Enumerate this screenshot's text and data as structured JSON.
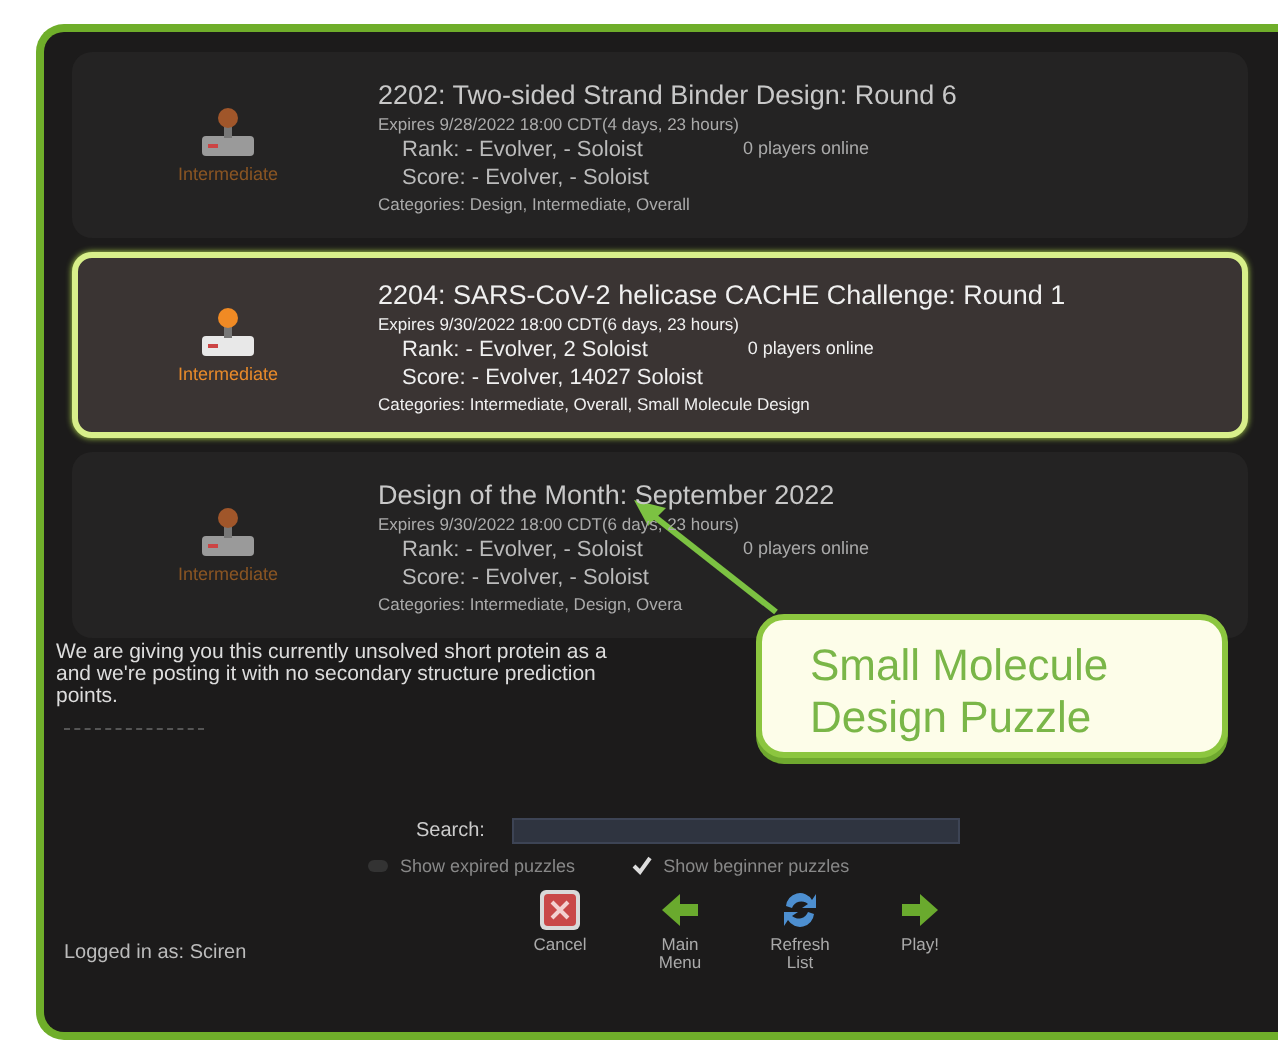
{
  "puzzles": [
    {
      "title": "2202: Two-sided Strand Binder Design: Round 6",
      "expires": "Expires 9/28/2022 18:00 CDT(4 days, 23 hours)",
      "rank": "Rank: - Evolver, - Soloist",
      "players": "0 players online",
      "score": "Score: - Evolver, - Soloist",
      "categories": "Categories: Design, Intermediate, Overall",
      "difficulty": "Intermediate",
      "selected": false
    },
    {
      "title": "2204: SARS-CoV-2 helicase CACHE Challenge: Round 1",
      "expires": "Expires 9/30/2022 18:00 CDT(6 days, 23 hours)",
      "rank": "Rank: - Evolver, 2 Soloist",
      "players": "0 players online",
      "score": "Score: - Evolver, 14027 Soloist",
      "categories": "Categories: Intermediate, Overall, Small Molecule Design",
      "difficulty": "Intermediate",
      "selected": true
    },
    {
      "title": "Design of the Month: September 2022",
      "expires": "Expires 9/30/2022 18:00 CDT(6 days, 23 hours)",
      "rank": "Rank: - Evolver, - Soloist",
      "players": "0 players online",
      "score": "Score: - Evolver, - Soloist",
      "categories": "Categories: Intermediate, Design, Overa",
      "difficulty": "Intermediate",
      "selected": false
    }
  ],
  "description": "We are giving you this currently unsolved short protein as a\nand we're posting it with no secondary structure prediction\npoints.",
  "search": {
    "label": "Search:"
  },
  "options": [
    {
      "label": "Show expired puzzles",
      "checked": false
    },
    {
      "label": "Show beginner puzzles",
      "checked": true
    }
  ],
  "buttons": [
    {
      "label": "Cancel",
      "kind": "cancel"
    },
    {
      "label": "Main\nMenu",
      "kind": "back"
    },
    {
      "label": "Refresh\nList",
      "kind": "refresh"
    },
    {
      "label": "Play!",
      "kind": "play"
    }
  ],
  "status": "Logged in as: Sciren",
  "callout": {
    "text": "Small Molecule\nDesign Puzzle"
  }
}
